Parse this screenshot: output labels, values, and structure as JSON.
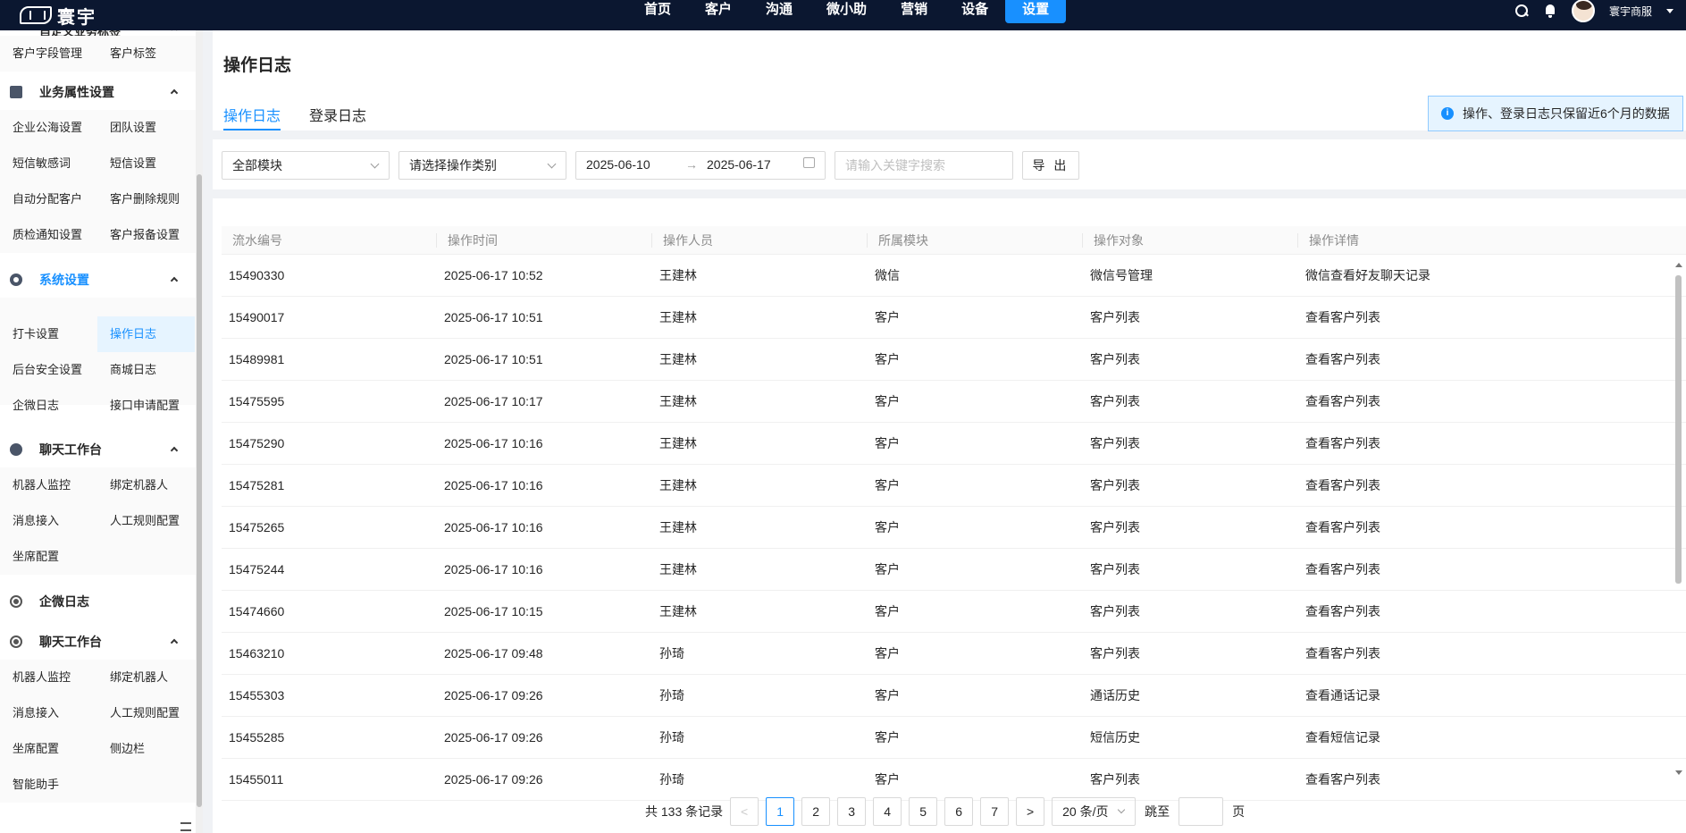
{
  "topbar": {
    "brand": "寰宇",
    "nav": [
      "首页",
      "客户",
      "沟通",
      "微小助",
      "营销",
      "设备",
      "设置"
    ],
    "active_nav": "设置",
    "user": "寰宇商服"
  },
  "sidebar": {
    "partial_top_title": "自定义业务标签",
    "groups": [
      {
        "title": "业务属性设置",
        "items": [
          "企业公海设置",
          "团队设置",
          "短信敏感词",
          "短信设置",
          "自动分配客户",
          "客户删除规则",
          "质检通知设置",
          "客户报备设置"
        ]
      },
      {
        "title": "系统设置",
        "items": [
          "打卡设置",
          "操作日志",
          "后台安全设置",
          "商城日志",
          "企微日志",
          "接口申请配置"
        ]
      },
      {
        "title": "聊天工作台",
        "items": [
          "机器人监控",
          "绑定机器人",
          "消息接入",
          "人工规则配置",
          "坐席配置"
        ]
      },
      {
        "title": "企微日志",
        "items": []
      },
      {
        "title": "聊天工作台",
        "items": [
          "机器人监控",
          "绑定机器人",
          "消息接入",
          "人工规则配置",
          "坐席配置",
          "侧边栏",
          "智能助手"
        ]
      }
    ],
    "top_items": [
      "客户字段管理",
      "客户标签"
    ],
    "active_item": "操作日志"
  },
  "page": {
    "title": "操作日志",
    "tabs": [
      "操作日志",
      "登录日志"
    ],
    "active_tab": "操作日志",
    "notice": "操作、登录日志只保留近6个月的数据"
  },
  "filters": {
    "module": "全部模块",
    "op_type_placeholder": "请选择操作类别",
    "date_start": "2025-06-10",
    "date_end": "2025-06-17",
    "keyword_placeholder": "请输入关键字搜索",
    "export": "导 出"
  },
  "table": {
    "columns": [
      "流水编号",
      "操作时间",
      "操作人员",
      "所属模块",
      "操作对象",
      "操作详情"
    ],
    "rows": [
      [
        "15490330",
        "2025-06-17 10:52",
        "王建林",
        "微信",
        "微信号管理",
        "微信查看好友聊天记录"
      ],
      [
        "15490017",
        "2025-06-17 10:51",
        "王建林",
        "客户",
        "客户列表",
        "查看客户列表"
      ],
      [
        "15489981",
        "2025-06-17 10:51",
        "王建林",
        "客户",
        "客户列表",
        "查看客户列表"
      ],
      [
        "15475595",
        "2025-06-17 10:17",
        "王建林",
        "客户",
        "客户列表",
        "查看客户列表"
      ],
      [
        "15475290",
        "2025-06-17 10:16",
        "王建林",
        "客户",
        "客户列表",
        "查看客户列表"
      ],
      [
        "15475281",
        "2025-06-17 10:16",
        "王建林",
        "客户",
        "客户列表",
        "查看客户列表"
      ],
      [
        "15475265",
        "2025-06-17 10:16",
        "王建林",
        "客户",
        "客户列表",
        "查看客户列表"
      ],
      [
        "15475244",
        "2025-06-17 10:16",
        "王建林",
        "客户",
        "客户列表",
        "查看客户列表"
      ],
      [
        "15474660",
        "2025-06-17 10:15",
        "王建林",
        "客户",
        "客户列表",
        "查看客户列表"
      ],
      [
        "15463210",
        "2025-06-17 09:48",
        "孙琦",
        "客户",
        "客户列表",
        "查看客户列表"
      ],
      [
        "15455303",
        "2025-06-17 09:26",
        "孙琦",
        "客户",
        "通话历史",
        "查看通话记录"
      ],
      [
        "15455285",
        "2025-06-17 09:26",
        "孙琦",
        "客户",
        "短信历史",
        "查看短信记录"
      ],
      [
        "15455011",
        "2025-06-17 09:26",
        "孙琦",
        "客户",
        "客户列表",
        "查看客户列表"
      ]
    ]
  },
  "pagination": {
    "total_text": "共 133 条记录",
    "pages": [
      "1",
      "2",
      "3",
      "4",
      "5",
      "6",
      "7"
    ],
    "current": "1",
    "page_size": "20 条/页",
    "jump_label": "跳至",
    "jump_suffix": "页"
  }
}
